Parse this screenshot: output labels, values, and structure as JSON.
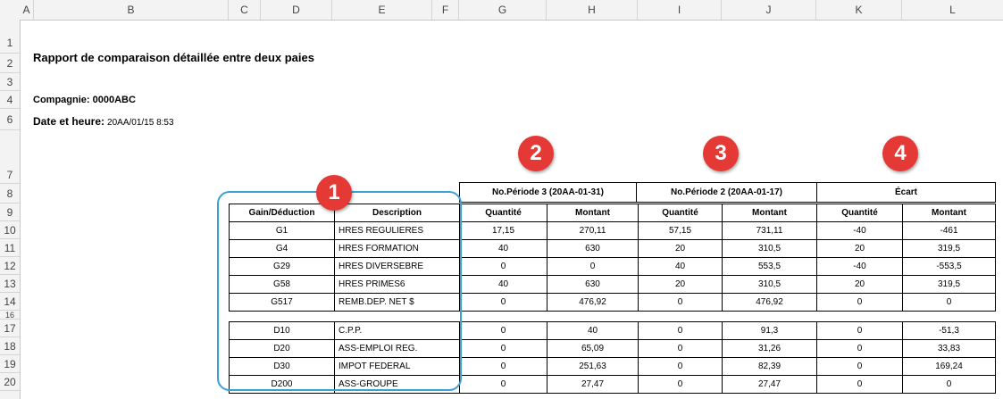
{
  "columns": [
    "A",
    "B",
    "C",
    "D",
    "E",
    "F",
    "G",
    "H",
    "I",
    "J",
    "K",
    "L"
  ],
  "rows": [
    "1",
    "2",
    "3",
    "4",
    "6",
    "7",
    "8",
    "9",
    "10",
    "11",
    "12",
    "13",
    "14",
    "16",
    "17",
    "18",
    "19",
    "20"
  ],
  "report": {
    "title": "Rapport de comparaison détaillée entre deux paies",
    "company_label": "Compagnie: 0000ABC",
    "datetime_label": "Date et heure:",
    "datetime_value": "20AA/01/15 8:53"
  },
  "table": {
    "period3": "No.Période 3 (20AA-01-31)",
    "period2": "No.Période 2 (20AA-01-17)",
    "ecart": "Écart",
    "col_code": "Gain/Déduction",
    "col_desc": "Description",
    "col_qty": "Quantité",
    "col_amt": "Montant",
    "gains": [
      [
        "G1",
        "HRES REGULIERES",
        "17,15",
        "270,11",
        "57,15",
        "731,11",
        "-40",
        "-461"
      ],
      [
        "G4",
        "HRES FORMATION",
        "40",
        "630",
        "20",
        "310,5",
        "20",
        "319,5"
      ],
      [
        "G29",
        "HRES DIVERSEBRE",
        "0",
        "0",
        "40",
        "553,5",
        "-40",
        "-553,5"
      ],
      [
        "G58",
        "HRES PRIMES6",
        "40",
        "630",
        "20",
        "310,5",
        "20",
        "319,5"
      ],
      [
        "G517",
        "REMB.DEP. NET $",
        "0",
        "476,92",
        "0",
        "476,92",
        "0",
        "0"
      ]
    ],
    "deductions": [
      [
        "D10",
        "C.P.P.",
        "0",
        "40",
        "0",
        "91,3",
        "0",
        "-51,3"
      ],
      [
        "D20",
        "ASS-EMPLOI REG.",
        "0",
        "65,09",
        "0",
        "31,26",
        "0",
        "33,83"
      ],
      [
        "D30",
        "IMPOT FEDERAL",
        "0",
        "251,63",
        "0",
        "82,39",
        "0",
        "169,24"
      ],
      [
        "D200",
        "ASS-GROUPE",
        "0",
        "27,47",
        "0",
        "27,47",
        "0",
        "0"
      ]
    ]
  },
  "badges": [
    "1",
    "2",
    "3",
    "4"
  ],
  "colors": {
    "badge": "#e53935",
    "callout": "#3aa0d8"
  }
}
